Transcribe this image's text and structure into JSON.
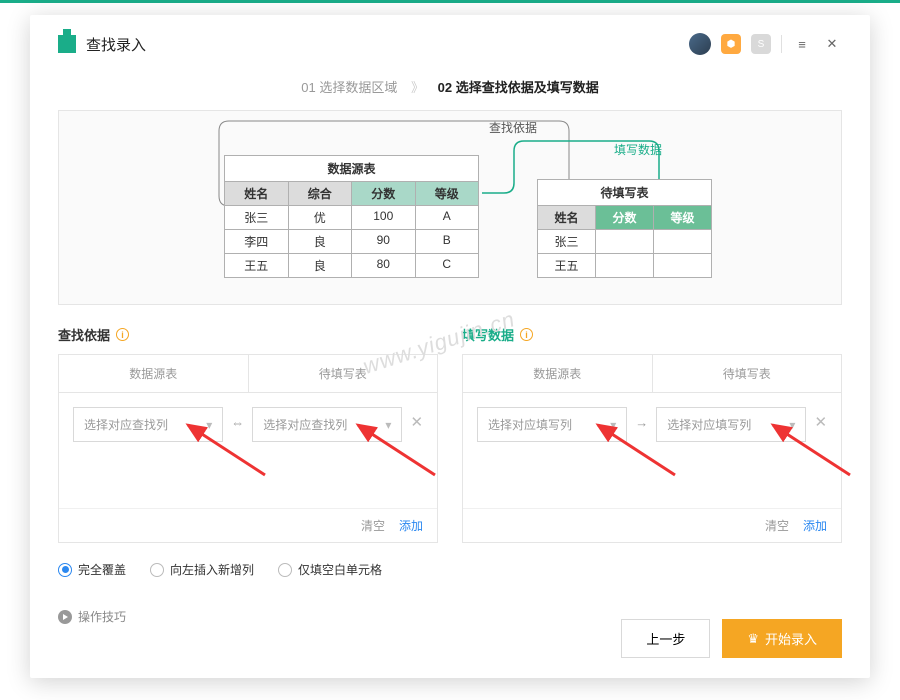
{
  "header": {
    "title": "查找录入"
  },
  "steps": {
    "s1": "01 选择数据区域",
    "sep": "》",
    "s2": "02 选择查找依据及填写数据"
  },
  "diagram": {
    "lookup_label": "查找依据",
    "fill_label": "填写数据",
    "src_title": "数据源表",
    "dst_title": "待填写表",
    "src_head": [
      "姓名",
      "综合",
      "分数",
      "等级"
    ],
    "src_rows": [
      [
        "张三",
        "优",
        "100",
        "A"
      ],
      [
        "李四",
        "良",
        "90",
        "B"
      ],
      [
        "王五",
        "良",
        "80",
        "C"
      ]
    ],
    "dst_head": [
      "姓名",
      "分数",
      "等级"
    ],
    "dst_rows": [
      [
        "张三",
        "",
        ""
      ],
      [
        "王五",
        "",
        ""
      ]
    ]
  },
  "sections": {
    "lookup": "查找依据",
    "fill": "填写数据"
  },
  "panel": {
    "col_src": "数据源表",
    "col_dst": "待填写表",
    "placeholder_lookup": "选择对应查找列",
    "placeholder_fill": "选择对应填写列",
    "swap": "⇔",
    "arrow": "→",
    "clear": "清空",
    "add": "添加"
  },
  "radios": {
    "r1": "完全覆盖",
    "r2": "向左插入新增列",
    "r3": "仅填空白单元格"
  },
  "tips": "操作技巧",
  "buttons": {
    "prev": "上一步",
    "start": "开始录入"
  },
  "watermark": "www.yigujin.cn"
}
